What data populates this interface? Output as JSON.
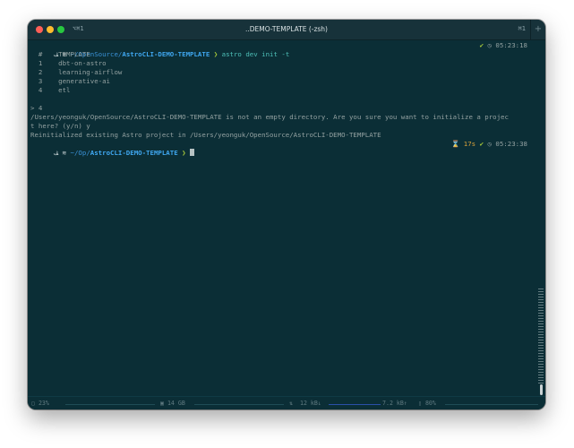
{
  "window": {
    "title": "..DEMO-TEMPLATE (-zsh)",
    "tab_left": "⌥⌘1",
    "tab_right": "⌘1",
    "new_tab_label": "+"
  },
  "terminal": {
    "prompt1": {
      "tag": "ﭫ ≋ ",
      "path_prefix": "~/OpenSource/",
      "path_bold": "AstroCLI-DEMO-TEMPLATE",
      "arrow": " ❯ ",
      "command": "astro dev init -t",
      "right_status": "✔",
      "right_time": "◷ 05:23:18"
    },
    "table_header": "  #    TEMPLATE",
    "templates": [
      "  1    dbt-on-astro",
      "  2    learning-airflow",
      "  3    generative-ai",
      "  4    etl"
    ],
    "selection": "> 4",
    "question_line1": "/Users/yeonguk/OpenSource/AstroCLI-DEMO-TEMPLATE is not an empty directory. Are you sure you want to initialize a projec",
    "question_line2": "t here? (y/n) y",
    "result": "Reinitialized existing Astro project in /Users/yeonguk/OpenSource/AstroCLI-DEMO-TEMPLATE",
    "prompt2": {
      "tag": "ﭫ ≋ ",
      "path_prefix": "~/Op/",
      "path_bold": "AstroCLI-DEMO-TEMPLATE",
      "arrow": " ❯ ",
      "right_duration": "⌛ 17s",
      "right_status": "✔",
      "right_time": "◷ 05:23:38"
    }
  },
  "statusbar": {
    "cpu": "▢ 23%",
    "mem": "▣ 14 GB",
    "net_icon": "⇅",
    "net_in": "12 kB↓",
    "net_out": "7.2 kB↑",
    "battery": "▯ 80%"
  }
}
